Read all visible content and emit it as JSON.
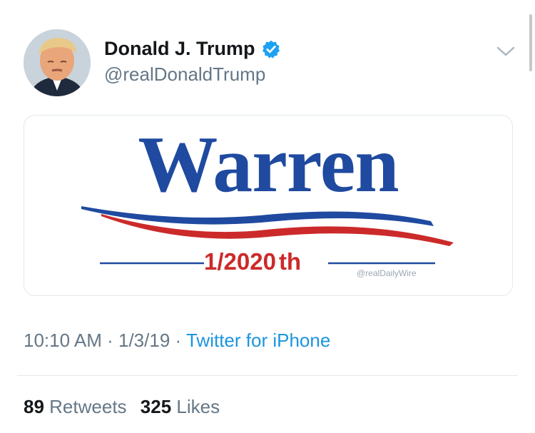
{
  "tweet": {
    "author": {
      "display_name": "Donald J. Trump",
      "handle": "@realDonaldTrump",
      "verified": true
    },
    "media": {
      "headline": "Warren",
      "fraction": "1/2020",
      "suffix": "th",
      "watermark": "@realDailyWire",
      "colors": {
        "blue": "#1f4aa0",
        "red": "#cc2a2a"
      }
    },
    "meta": {
      "time": "10:10 AM",
      "separator": "·",
      "date": "1/3/19",
      "client": "Twitter for iPhone"
    },
    "stats": {
      "retweets_count": "89",
      "retweets_label": "Retweets",
      "likes_count": "325",
      "likes_label": "Likes"
    }
  },
  "icons": {
    "verified": "verified-badge-icon",
    "menu": "chevron-down-icon"
  },
  "colors": {
    "text_primary": "#14171a",
    "text_secondary": "#657786",
    "link": "#1b95e0",
    "verified": "#1da1f2"
  }
}
